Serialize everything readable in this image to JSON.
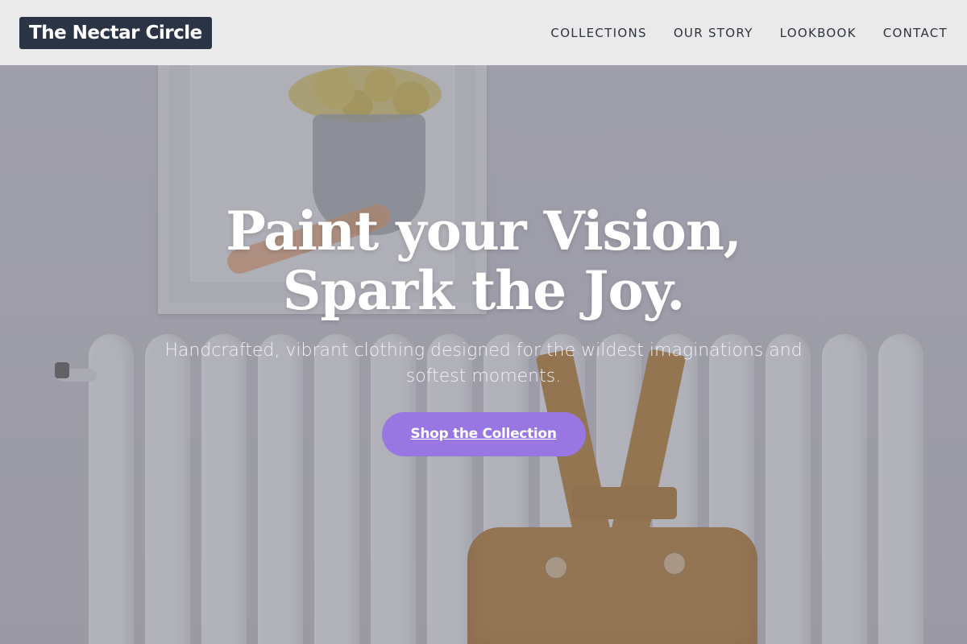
{
  "header": {
    "logo": "The Nectar Circle",
    "nav": [
      {
        "label": "COLLECTIONS"
      },
      {
        "label": "OUR STORY"
      },
      {
        "label": "LOOKBOOK"
      },
      {
        "label": "CONTACT"
      }
    ]
  },
  "hero": {
    "headline_line1": "Paint your Vision,",
    "headline_line2": "Spark the Joy.",
    "subtext": "Handcrafted, vibrant clothing designed for the wildest imaginations and softest moments.",
    "cta_label": "Shop the Collection"
  },
  "colors": {
    "logo_bg": "#2b3445",
    "cta_bg": "#9877e2",
    "header_bg": "#f0f0f0",
    "nav_text": "#2d3340"
  }
}
